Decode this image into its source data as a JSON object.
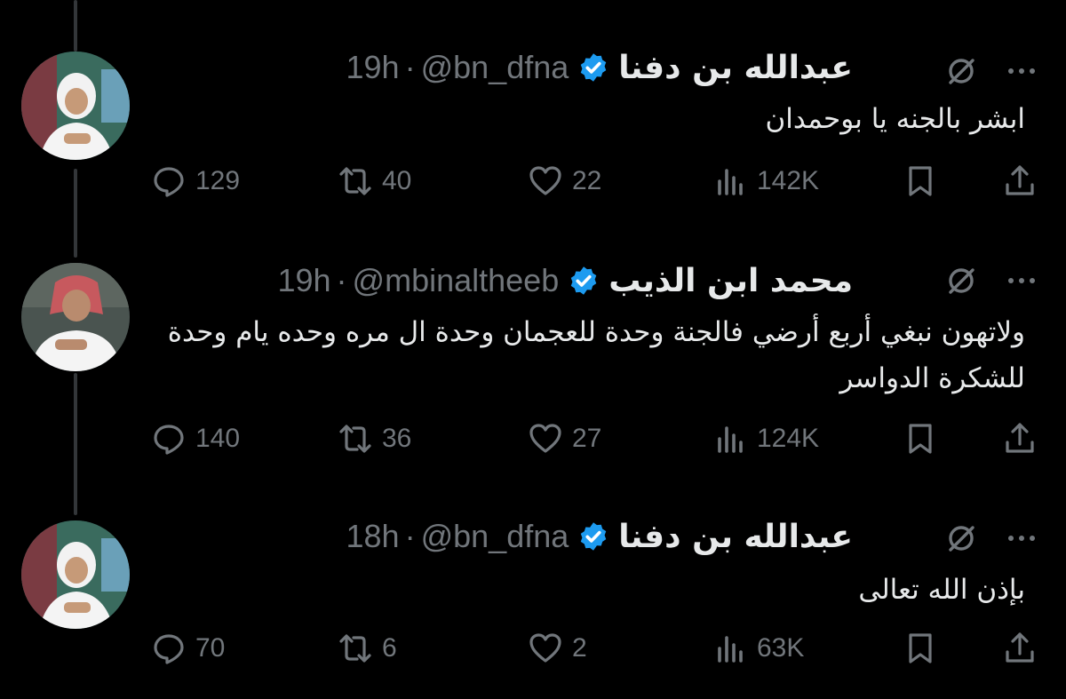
{
  "tweets": [
    {
      "name": "عبدالله بن دفنا",
      "handle": "@bn_dfna",
      "separator": "·",
      "time": "19h",
      "text": "ابشر بالجنه يا بوحمدان",
      "replies": "129",
      "reposts": "40",
      "likes": "22",
      "views": "142K"
    },
    {
      "name": "محمد ابن الذيب",
      "handle": "@mbinaltheeb",
      "separator": "·",
      "time": "19h",
      "text": "ولاتهون نبغي أربع أرضي فالجنة وحدة للعجمان وحدة ال مره وحده يام وحدة للشكرة الدواسر",
      "replies": "140",
      "reposts": "36",
      "likes": "27",
      "views": "124K"
    },
    {
      "name": "عبدالله بن دفنا",
      "handle": "@bn_dfna",
      "separator": "·",
      "time": "18h",
      "text": "بإذن الله تعالى",
      "replies": "70",
      "reposts": "6",
      "likes": "2",
      "views": "63K"
    }
  ],
  "colors": {
    "background": "#000000",
    "primary_text": "#e7e9ea",
    "secondary_text": "#71767b",
    "verified_blue": "#1d9bf0",
    "thread_line": "#333639"
  },
  "icons": {
    "verified": "verified-badge-icon",
    "grok": "grok-icon",
    "more": "more-icon",
    "reply": "reply-icon",
    "repost": "repost-icon",
    "like": "like-icon",
    "views": "views-icon",
    "bookmark": "bookmark-icon",
    "share": "share-icon"
  }
}
